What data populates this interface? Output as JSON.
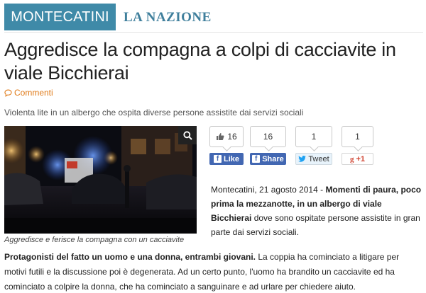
{
  "header": {
    "section": "MONTECATINI",
    "masthead": "LA NAZIONE"
  },
  "article": {
    "title": "Aggredisce la compagna a colpi di cacciavite in viale Bicchierai",
    "comments_label": "Commenti",
    "subtitle": "Violenta lite in un albergo che ospita diverse persone assistite dai servizi sociali",
    "photo_caption": "Aggredisce e ferisce la compagna con un cacciavite",
    "dateline": "Montecatini, 21 agosto 2014 - ",
    "lead_bold": "Momenti di paura, poco prima la mezzanotte, in un albergo di viale Bicchierai",
    "lead_rest": " dove sono ospitate persone assistite in gran parte dai servizi sociali.",
    "para2_bold": "Protagonisti del fatto un uomo e una donna, entrambi giovani.",
    "para2_rest": " La coppia ha cominciato a litigare per motivi futili e la discussione poi è degenerata. Ad un certo punto, l'uomo ha brandito un cacciavite ed ha cominciato a colpire la donna, che ha cominciato a sanguinare e ad urlare per chiedere aiuto."
  },
  "social": {
    "fb_like_count": "16",
    "fb_like_label": "Like",
    "fb_share_count": "16",
    "fb_share_label": "Share",
    "tweet_count": "1",
    "tweet_label": "Tweet",
    "gplus_count": "1",
    "gplus_label": "+1"
  },
  "colors": {
    "section_tab": "#3f8aa8",
    "masthead": "#3f7f9c",
    "comments": "#e07b1a",
    "facebook": "#4267b2"
  }
}
